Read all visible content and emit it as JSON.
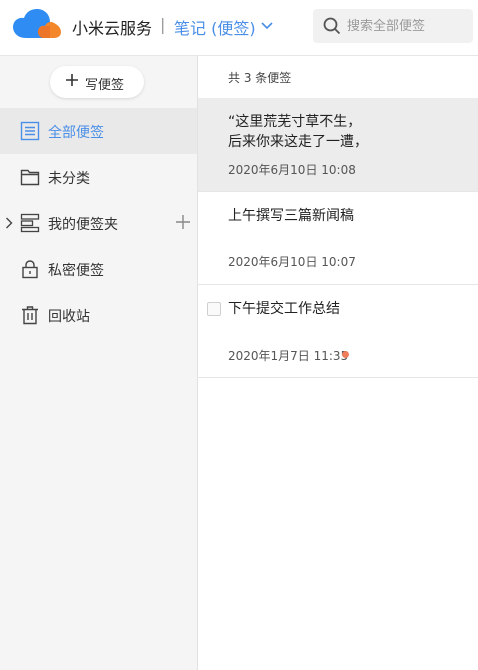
{
  "header": {
    "brand": "小米云服务",
    "separator": "|",
    "app_name": "笔记 (便签)",
    "search_placeholder": "搜索全部便签"
  },
  "sidebar": {
    "write_button": "写便签",
    "items": [
      {
        "label": "全部便签",
        "icon": "note-list-icon",
        "active": true
      },
      {
        "label": "未分类",
        "icon": "folder-icon"
      },
      {
        "label": "我的便签夹",
        "icon": "folders-stack-icon"
      },
      {
        "label": "私密便签",
        "icon": "lock-icon"
      },
      {
        "label": "回收站",
        "icon": "trash-icon"
      }
    ]
  },
  "list": {
    "count": "共 3 条便签",
    "notes": [
      {
        "line1": "“这里荒芜寸草不生，",
        "line2": "后来你来这走了一遭，",
        "date": "2020年6月10日 10:08"
      },
      {
        "line1": "上午撰写三篇新闻稿",
        "date": "2020年6月10日 10:07"
      },
      {
        "line1": "下午提交工作总结",
        "date": "2020年1月7日 11:35",
        "reminder_dot": true
      }
    ]
  },
  "colors": {
    "accent": "#4a8fe7",
    "logo_blue": "#2f8cf3",
    "logo_orange": "#f5872b",
    "reminder_dot": "#ee7d5b"
  }
}
